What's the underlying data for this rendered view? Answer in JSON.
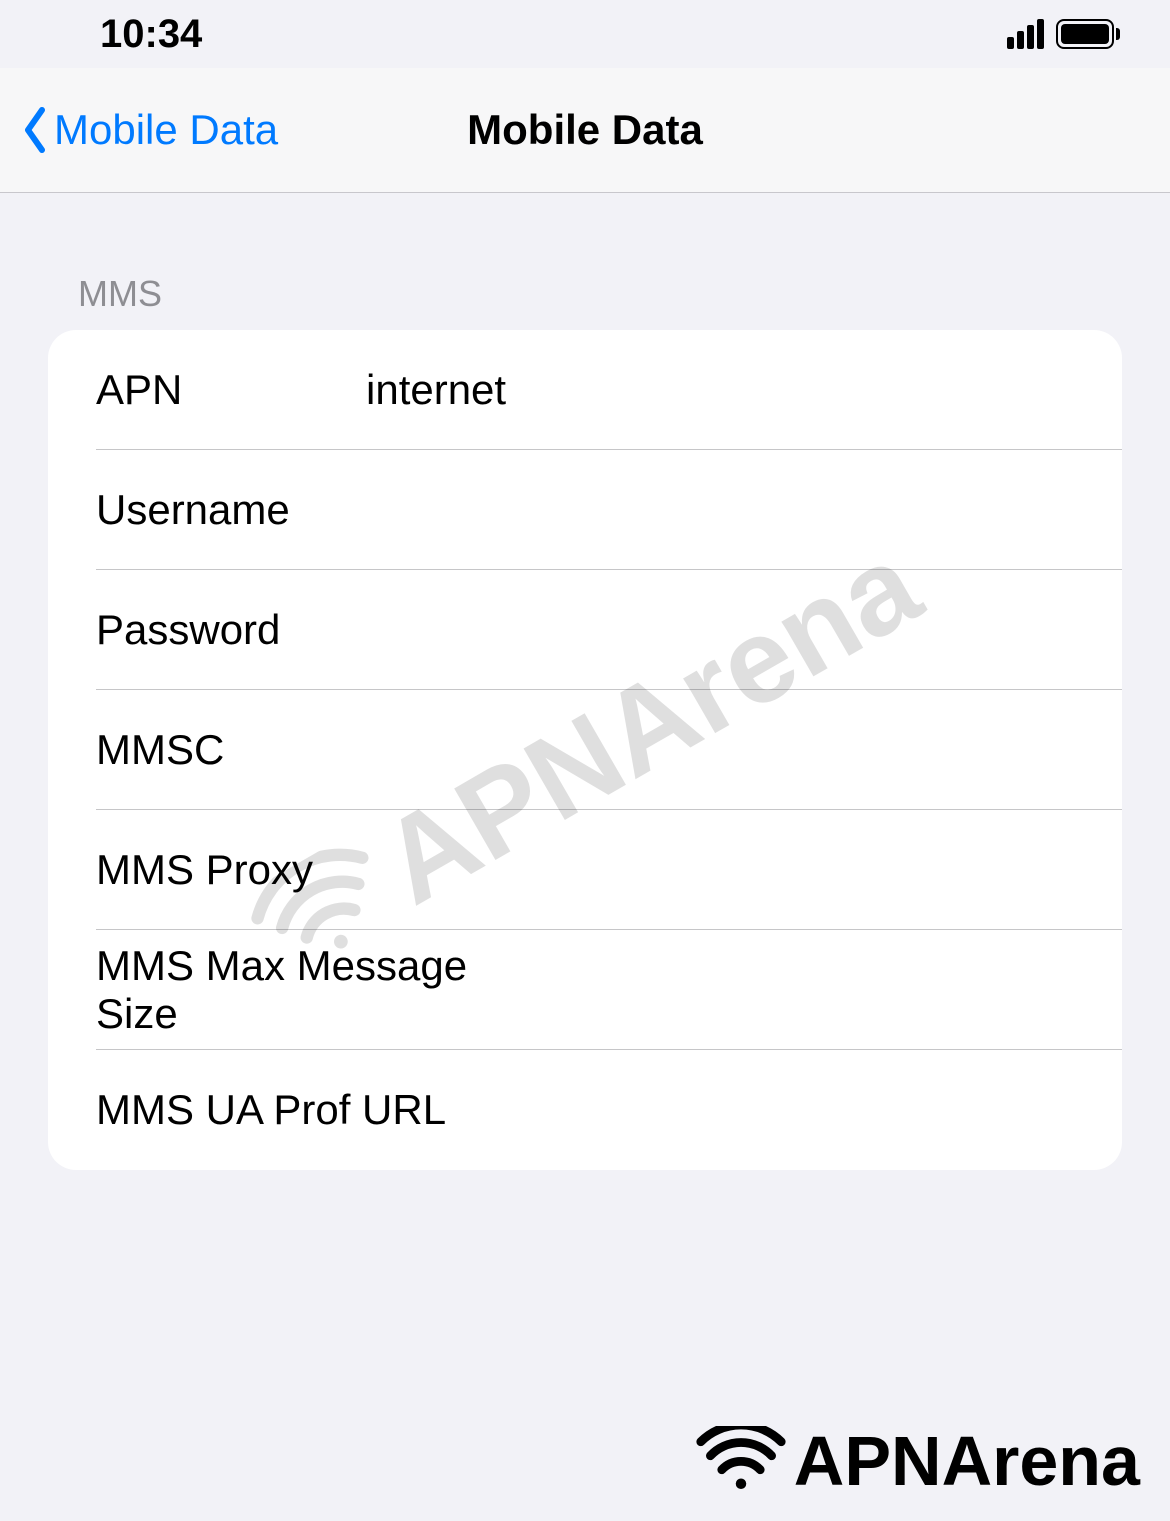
{
  "status_bar": {
    "time": "10:34"
  },
  "nav": {
    "back_label": "Mobile Data",
    "title": "Mobile Data"
  },
  "section_header": "MMS",
  "fields": {
    "apn": {
      "label": "APN",
      "value": "internet"
    },
    "username": {
      "label": "Username",
      "value": ""
    },
    "password": {
      "label": "Password",
      "value": ""
    },
    "mmsc": {
      "label": "MMSC",
      "value": ""
    },
    "mms_proxy": {
      "label": "MMS Proxy",
      "value": ""
    },
    "mms_max_size": {
      "label": "MMS Max Message Size",
      "value": ""
    },
    "mms_ua_prof": {
      "label": "MMS UA Prof URL",
      "value": ""
    }
  },
  "watermark": "APNArena",
  "footer_brand": "APNArena"
}
